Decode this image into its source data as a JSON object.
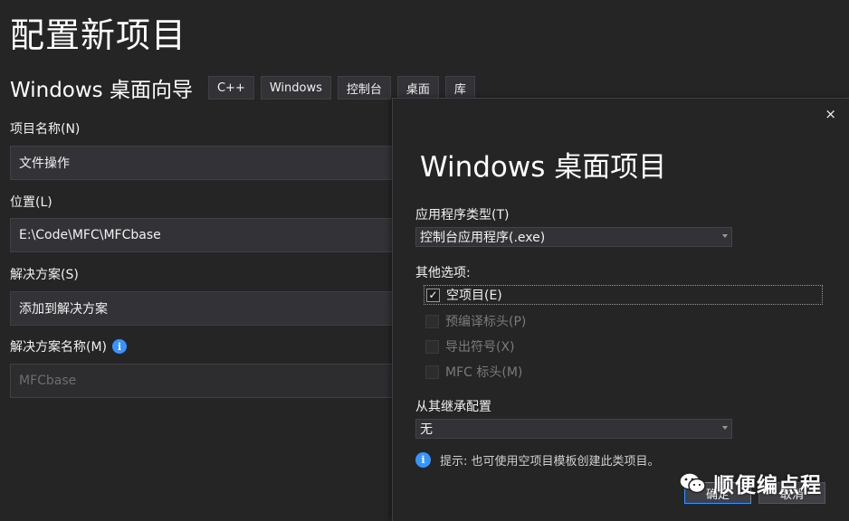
{
  "page": {
    "title": "配置新项目",
    "subtitle": "Windows 桌面向导",
    "tags": [
      "C++",
      "Windows",
      "控制台",
      "桌面",
      "库"
    ]
  },
  "form": {
    "project_name_label": "项目名称(N)",
    "project_name_value": "文件操作",
    "location_label": "位置(L)",
    "location_value": "E:\\Code\\MFC\\MFCbase",
    "solution_label": "解决方案(S)",
    "solution_value": "添加到解决方案",
    "solution_name_label": "解决方案名称(M)",
    "solution_name_value": "MFCbase"
  },
  "dialog": {
    "close": "×",
    "title": "Windows 桌面项目",
    "app_type_label": "应用程序类型(T)",
    "app_type_value": "控制台应用程序(.exe)",
    "other_options_label": "其他选项:",
    "options": [
      {
        "label": "空项目(E)",
        "checked": true,
        "enabled": true
      },
      {
        "label": "预编译标头(P)",
        "checked": false,
        "enabled": false
      },
      {
        "label": "导出符号(X)",
        "checked": false,
        "enabled": false
      },
      {
        "label": "MFC 标头(M)",
        "checked": false,
        "enabled": false
      }
    ],
    "inherit_label": "从其继承配置",
    "inherit_value": "无",
    "hint": "提示: 也可使用空项目模板创建此类项目。",
    "ok_label": "确定",
    "cancel_label": "取消"
  },
  "watermark": {
    "text": "顺便编点程"
  },
  "colors": {
    "background": "#252526",
    "field": "#333337",
    "accent": "#3794ff"
  }
}
